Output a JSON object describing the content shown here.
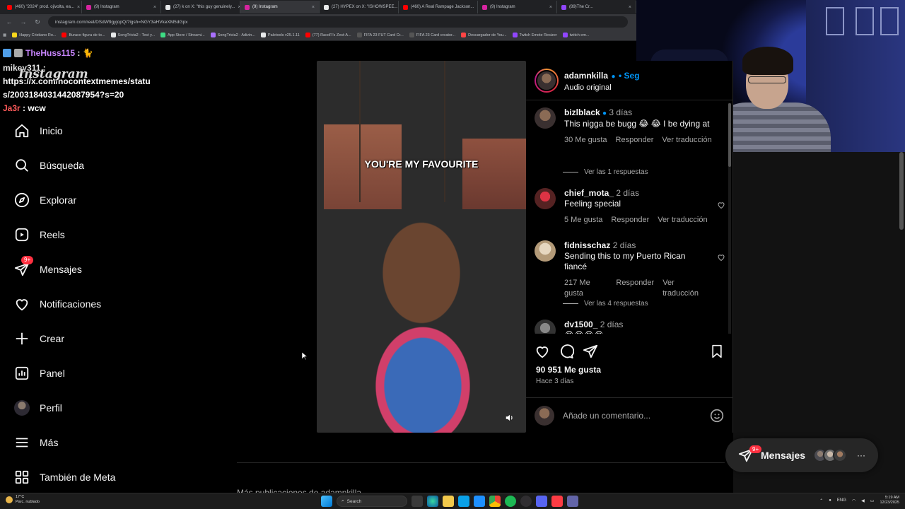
{
  "browser": {
    "tabs": [
      {
        "title": "(460) \"2024\" prod. ojivolta, ea...",
        "color": "#ff0000"
      },
      {
        "title": "(9) Instagram",
        "color": "#d6249f"
      },
      {
        "title": "(27) k on X: \"this guy genuinely...",
        "color": "#e7e9ea"
      },
      {
        "title": "(9) Instagram",
        "color": "#d6249f"
      },
      {
        "title": "(27) HYPEX on X: \"ISHOWSPEE...",
        "color": "#e7e9ea"
      },
      {
        "title": "(460) A Real Rampage Jackson...",
        "color": "#ff0000"
      },
      {
        "title": "(9) Instagram",
        "color": "#d6249f"
      },
      {
        "title": "(89)The Cr...",
        "color": "#9146ff"
      }
    ],
    "url": "instagram.com/reel/DSdW9gyjopQ/?igsh=NGY3aHVkeXM5dGpx",
    "bookmarks": [
      {
        "label": "Happy Cristiano Ro...",
        "color": "#f9d71c"
      },
      {
        "label": "Buraco figura de to...",
        "color": "#ff0000"
      },
      {
        "label": "SongTrivia2 - Test y...",
        "color": "#e7e9ea"
      },
      {
        "label": "App Store / Streami...",
        "color": "#3ddc84"
      },
      {
        "label": "SongTrivia2 - Adivin...",
        "color": "#a970ff"
      },
      {
        "label": "Paletools v25.1.11",
        "color": "#e7e9ea"
      },
      {
        "label": "(77) RacoFi's Zest-A...",
        "color": "#ff0000"
      },
      {
        "label": "FIFA 23 FUT Card Cr...",
        "color": "#555555"
      },
      {
        "label": "FIFA 23 Card creator...",
        "color": "#555555"
      },
      {
        "label": "Descargador de You...",
        "color": "#ff4444"
      },
      {
        "label": "Twitch Emote Resizer",
        "color": "#9146ff"
      },
      {
        "label": "twitch em...",
        "color": "#9146ff"
      }
    ]
  },
  "chat": {
    "messages": [
      {
        "user": "TheHuss115",
        "text": "🐈"
      },
      {
        "user": "mikey311",
        "text": "https://x.com/nocontextmemes/status/2003184031442087954?s=20"
      },
      {
        "user": "Ja3r",
        "text": "wcw"
      }
    ],
    "watermark": "Instagram"
  },
  "sidebar": {
    "items": [
      {
        "label": "Inicio",
        "icon": "home-icon"
      },
      {
        "label": "Búsqueda",
        "icon": "search-icon"
      },
      {
        "label": "Explorar",
        "icon": "compass-icon"
      },
      {
        "label": "Reels",
        "icon": "reels-icon"
      },
      {
        "label": "Mensajes",
        "icon": "messenger-icon",
        "badge": "9+"
      },
      {
        "label": "Notificaciones",
        "icon": "heart-icon"
      },
      {
        "label": "Crear",
        "icon": "plus-icon"
      },
      {
        "label": "Panel",
        "icon": "chart-icon"
      },
      {
        "label": "Perfil",
        "icon": "avatar"
      },
      {
        "label": "Más",
        "icon": "menu-icon"
      },
      {
        "label": "También de Meta",
        "icon": "meta-icon"
      }
    ]
  },
  "video": {
    "caption": "YOU'RE MY FAVOURITE"
  },
  "post": {
    "username": "adamnkilla",
    "follow": "• Seg",
    "audio": "Audio original",
    "likes": "90 951 Me gusta",
    "date": "Hace 3 días",
    "add_comment_placeholder": "Añade un comentario...",
    "comments": [
      {
        "user": "bizlblack",
        "time": "3 días",
        "text": "This nigga be bugg 😂 😂 I be dying at",
        "likes": "30 Me gusta",
        "reply": "Responder",
        "translate": "Ver traducción",
        "view_replies": "Ver las 1 respuestas"
      },
      {
        "user": "chief_mota_",
        "time": "2 días",
        "text": "Feeling special",
        "likes": "5 Me gusta",
        "reply": "Responder",
        "translate": "Ver traducción"
      },
      {
        "user": "fidnisschaz",
        "time": "2 días",
        "text": "Sending this to my Puerto Rican fiancé",
        "likes": "217 Me gusta",
        "reply": "Responder",
        "translate": "Ver traducción",
        "view_replies": "Ver las 4 respuestas"
      },
      {
        "user": "dv1500_",
        "time": "2 días",
        "text": "😂😂😂😂"
      }
    ],
    "more_from": "Más publicaciones de adamnkilla"
  },
  "floating": {
    "label": "Mensajes",
    "badge": "9+"
  },
  "taskbar": {
    "weather_temp": "17°C",
    "weather_desc": "Parc. nublado",
    "search": "Search",
    "lang": "ENG",
    "time": "5:19 AM",
    "date": "12/23/2025"
  }
}
